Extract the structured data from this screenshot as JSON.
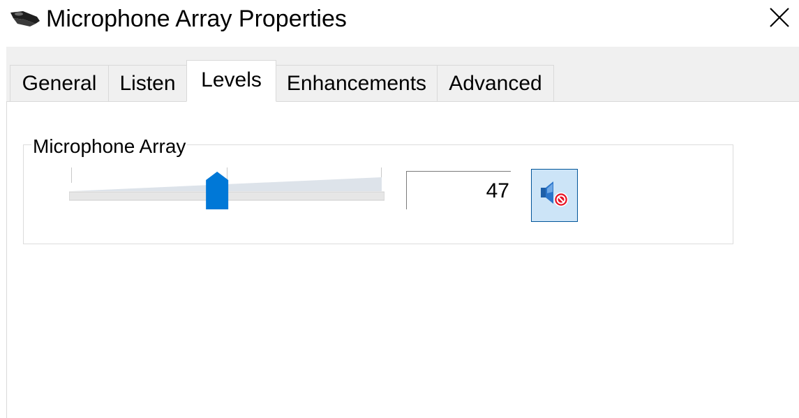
{
  "window": {
    "title": "Microphone Array Properties",
    "icon": "microphone-array-icon"
  },
  "title_bar": {
    "close_icon": "close-icon"
  },
  "tabs": [
    {
      "label": "General",
      "active": false
    },
    {
      "label": "Listen",
      "active": false
    },
    {
      "label": "Levels",
      "active": true
    },
    {
      "label": "Enhancements",
      "active": false
    },
    {
      "label": "Advanced",
      "active": false
    }
  ],
  "levels": {
    "group_label": "Microphone Array",
    "slider_value": 47,
    "slider_max": 100,
    "value_text": "47",
    "mute_icon": "speaker-muted-icon"
  },
  "colors": {
    "accent": "#0078d7",
    "mute_bg": "#cce4f7",
    "mute_border": "#005499",
    "mute_badge": "#e81123"
  }
}
